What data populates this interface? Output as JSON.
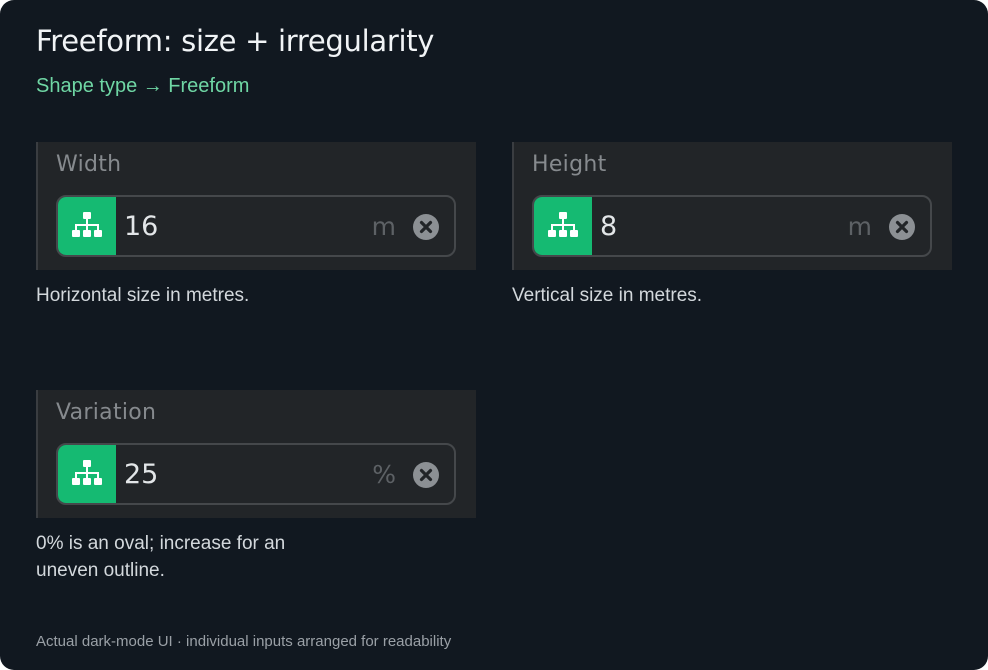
{
  "header": {
    "title": "Freeform: size + irregularity",
    "subtitle": "Shape type → Freeform"
  },
  "fields": {
    "width": {
      "label": "Width",
      "value": "16",
      "unit": "m",
      "help": "Horizontal size in metres."
    },
    "height": {
      "label": "Height",
      "value": "8",
      "unit": "m",
      "help": "Vertical size in metres."
    },
    "variation": {
      "label": "Variation",
      "value": "25",
      "unit": "%",
      "help_line1": "0% is an oval; increase for an",
      "help_line2": "uneven outline."
    }
  },
  "icons": {
    "prefix": "hierarchy-icon",
    "clear": "clear-icon"
  },
  "colors": {
    "background": "#111820",
    "field_background": "#222528",
    "accent": "#15ba72",
    "subtitle": "#6fd6a4"
  },
  "footer": {
    "note": "Actual dark-mode UI · individual inputs arranged for readability"
  }
}
